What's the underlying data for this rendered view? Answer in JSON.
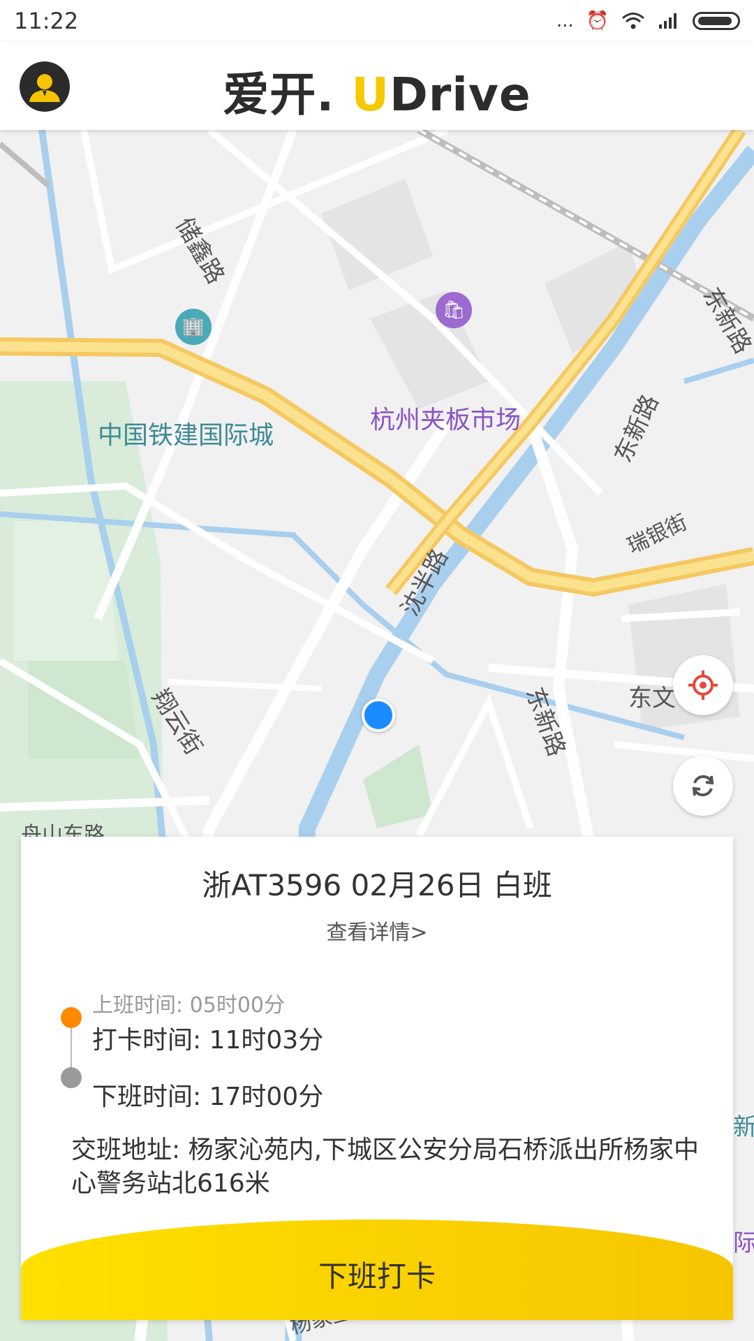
{
  "status_bar": {
    "time": "11:22",
    "more": "..."
  },
  "header": {
    "logo_main": "爱开.",
    "logo_u": "U",
    "logo_rest": "Drive"
  },
  "map": {
    "labels": {
      "chuxin": "储鑫路",
      "market": "杭州夹板市场",
      "tiejian": "中国铁建国际城",
      "dongxin_top": "东新路",
      "dongxin_mid": "东新路",
      "ruiyin": "瑞银街",
      "shenban": "沈半路",
      "dongxin_low": "东新路",
      "dongwen": "东文",
      "xiangyun": "翔云街",
      "zhoushan": "舟山东路",
      "xin_edge": "新",
      "ji_edge": "际",
      "yangjia": "杨家里"
    }
  },
  "card": {
    "title": "浙AT3596 02月26日 白班",
    "details_link": "查看详情>",
    "start_time": "上班时间: 05时00分",
    "clock_time": "打卡时间: 11时03分",
    "end_time": "下班时间: 17时00分",
    "address": "交班地址: 杨家沁苑内,下城区公安分局石桥派出所杨家中心警务站北616米",
    "button": "下班打卡"
  },
  "colors": {
    "accent": "#f6c500",
    "orange_dot": "#ff8a00",
    "gray_dot": "#9a9a9a",
    "location_blue": "#1a8cff",
    "poi_teal": "#4aaab8",
    "poi_purple": "#9c6ad0"
  }
}
